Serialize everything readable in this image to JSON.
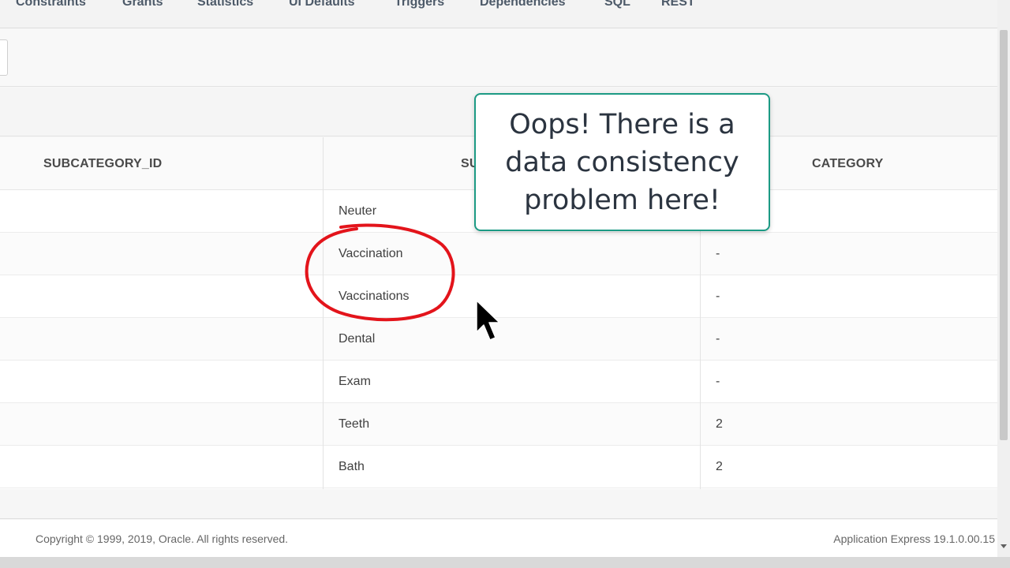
{
  "tabs": [
    "Constraints",
    "Grants",
    "Statistics",
    "UI Defaults",
    "Triggers",
    "Dependencies",
    "SQL",
    "REST"
  ],
  "grid": {
    "columns": {
      "subcategory_id": "SUBCATEGORY_ID",
      "subcategory_partial": "SU",
      "category": "CATEGORY"
    },
    "rows": [
      {
        "subcategory": "Neuter",
        "category": ""
      },
      {
        "subcategory": "Vaccination",
        "category": "-"
      },
      {
        "subcategory": "Vaccinations",
        "category": "-"
      },
      {
        "subcategory": "Dental",
        "category": "-"
      },
      {
        "subcategory": "Exam",
        "category": "-"
      },
      {
        "subcategory": "Teeth",
        "category": "2"
      },
      {
        "subcategory": "Bath",
        "category": "2"
      }
    ]
  },
  "callout": {
    "text": "Oops!  There is a\ndata consistency\nproblem here!"
  },
  "footer": {
    "copyright": "Copyright © 1999, 2019, Oracle. All rights reserved.",
    "version": "Application Express 19.1.0.00.15"
  },
  "colors": {
    "annotation_circle": "#e3141b",
    "callout_border": "#1c9a84",
    "header_text": "#4d5a69"
  },
  "icons": {
    "cursor": "mouse-pointer-icon"
  }
}
